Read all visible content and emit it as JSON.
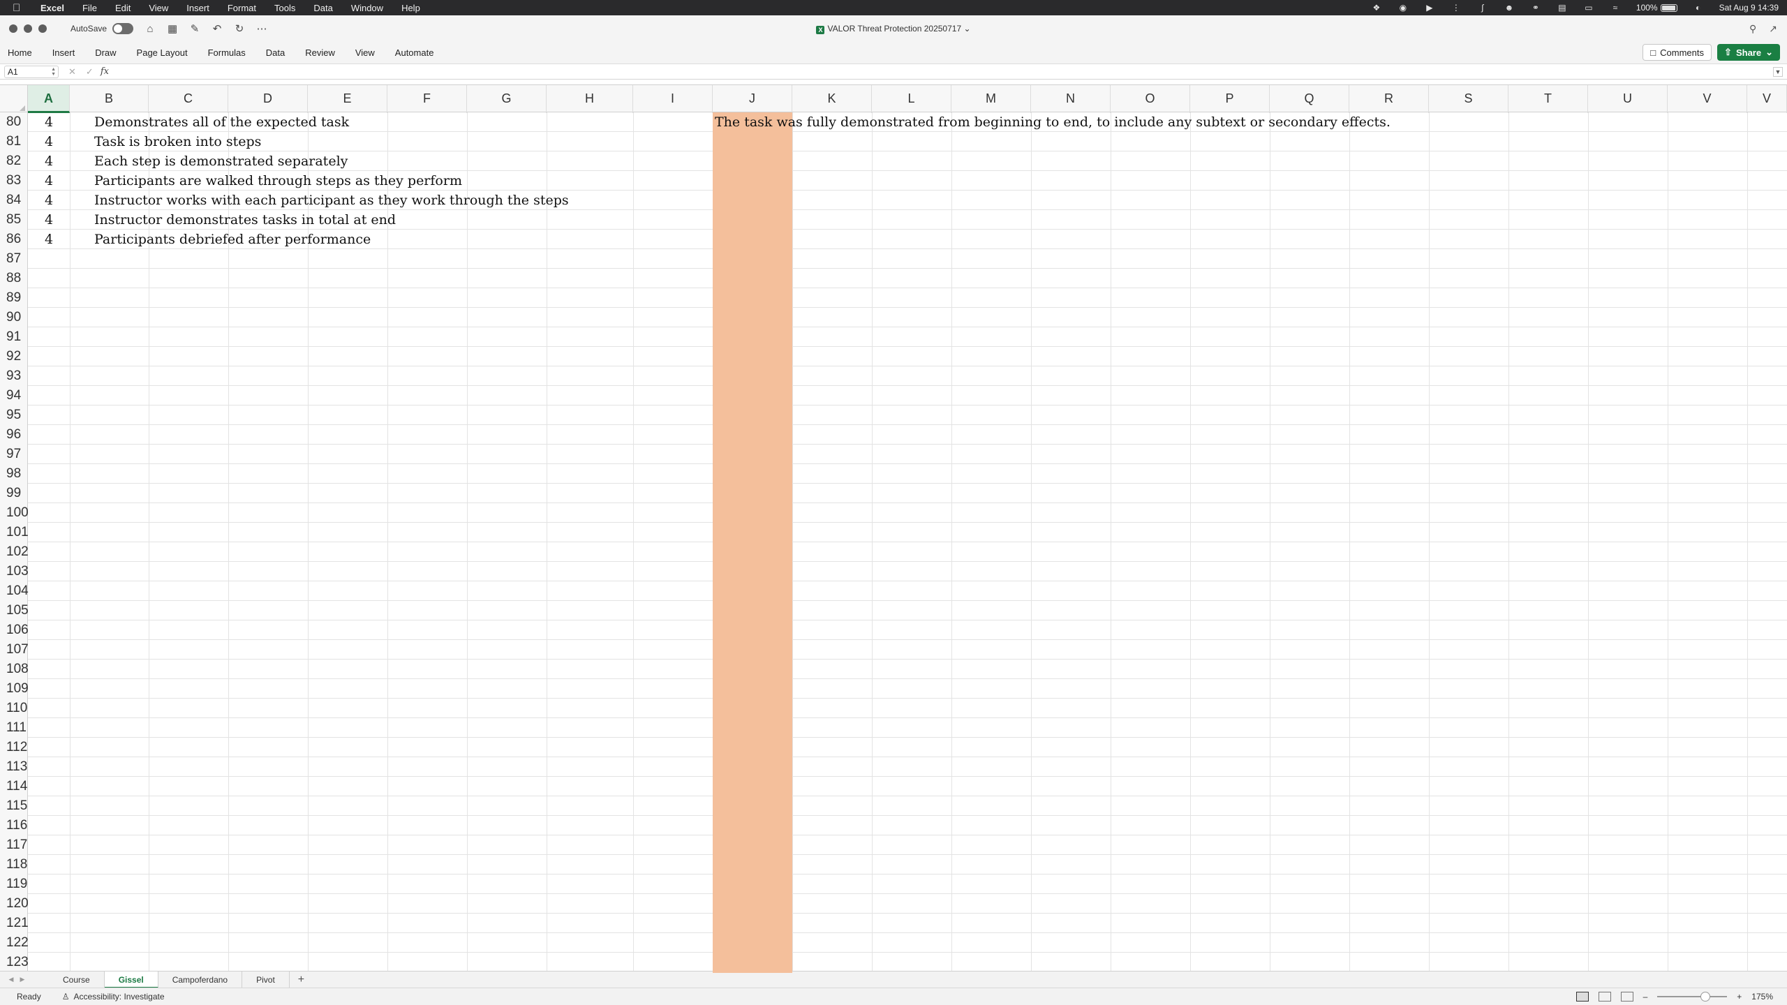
{
  "menubar": {
    "apple": "",
    "items": [
      "Excel",
      "File",
      "Edit",
      "View",
      "Insert",
      "Format",
      "Tools",
      "Data",
      "Window",
      "Help"
    ],
    "battery": "100%",
    "datetime": "Sat Aug 9  14:39"
  },
  "titlebar": {
    "autosave_label": "AutoSave",
    "doc_title": "VALOR Threat Protection 20250717",
    "excel_glyph": "X"
  },
  "ribbon": {
    "tabs": [
      "Home",
      "Insert",
      "Draw",
      "Page Layout",
      "Formulas",
      "Data",
      "Review",
      "View",
      "Automate"
    ],
    "comments_label": "Comments",
    "share_label": "Share"
  },
  "formula_bar": {
    "name_box": "A1",
    "fx": "fx",
    "value": ""
  },
  "columns": [
    "A",
    "B",
    "C",
    "D",
    "E",
    "F",
    "G",
    "H",
    "I",
    "J",
    "K",
    "L",
    "M",
    "N",
    "O",
    "P",
    "Q",
    "R",
    "S",
    "T",
    "U",
    "V",
    "V"
  ],
  "selected_column": "A",
  "filled_column": {
    "letter": "J",
    "color": "#f4bf9b"
  },
  "rows": [
    {
      "num": "80",
      "a": "4",
      "b": "Demonstrates all of the expected task",
      "j": "The task was fully demonstrated from beginning to end, to include any subtext or secondary effects."
    },
    {
      "num": "81",
      "a": "4",
      "b": "Task is broken into steps",
      "j": ""
    },
    {
      "num": "82",
      "a": "4",
      "b": "Each step is demonstrated separately",
      "j": ""
    },
    {
      "num": "83",
      "a": "4",
      "b": "Participants are walked through steps as they perform",
      "j": ""
    },
    {
      "num": "84",
      "a": "4",
      "b": "Instructor works with each participant as they work through the steps",
      "j": ""
    },
    {
      "num": "85",
      "a": "4",
      "b": "Instructor demonstrates tasks in total at end",
      "j": ""
    },
    {
      "num": "86",
      "a": "4",
      "b": "Participants debriefed after performance",
      "j": ""
    },
    {
      "num": "87",
      "a": "",
      "b": "",
      "j": ""
    },
    {
      "num": "88",
      "a": "",
      "b": "",
      "j": ""
    },
    {
      "num": "89",
      "a": "",
      "b": "",
      "j": ""
    },
    {
      "num": "90",
      "a": "",
      "b": "",
      "j": ""
    },
    {
      "num": "91",
      "a": "",
      "b": "",
      "j": ""
    },
    {
      "num": "92",
      "a": "",
      "b": "",
      "j": ""
    },
    {
      "num": "93",
      "a": "",
      "b": "",
      "j": ""
    },
    {
      "num": "94",
      "a": "",
      "b": "",
      "j": ""
    },
    {
      "num": "95",
      "a": "",
      "b": "",
      "j": ""
    },
    {
      "num": "96",
      "a": "",
      "b": "",
      "j": ""
    },
    {
      "num": "97",
      "a": "",
      "b": "",
      "j": ""
    },
    {
      "num": "98",
      "a": "",
      "b": "",
      "j": ""
    },
    {
      "num": "99",
      "a": "",
      "b": "",
      "j": ""
    },
    {
      "num": "100",
      "a": "",
      "b": "",
      "j": ""
    },
    {
      "num": "101",
      "a": "",
      "b": "",
      "j": ""
    },
    {
      "num": "102",
      "a": "",
      "b": "",
      "j": ""
    },
    {
      "num": "103",
      "a": "",
      "b": "",
      "j": ""
    },
    {
      "num": "104",
      "a": "",
      "b": "",
      "j": ""
    },
    {
      "num": "105",
      "a": "",
      "b": "",
      "j": ""
    },
    {
      "num": "106",
      "a": "",
      "b": "",
      "j": ""
    },
    {
      "num": "107",
      "a": "",
      "b": "",
      "j": ""
    },
    {
      "num": "108",
      "a": "",
      "b": "",
      "j": ""
    },
    {
      "num": "109",
      "a": "",
      "b": "",
      "j": ""
    },
    {
      "num": "110",
      "a": "",
      "b": "",
      "j": ""
    },
    {
      "num": "111",
      "a": "",
      "b": "",
      "j": ""
    },
    {
      "num": "112",
      "a": "",
      "b": "",
      "j": ""
    },
    {
      "num": "113",
      "a": "",
      "b": "",
      "j": ""
    },
    {
      "num": "114",
      "a": "",
      "b": "",
      "j": ""
    },
    {
      "num": "115",
      "a": "",
      "b": "",
      "j": ""
    },
    {
      "num": "116",
      "a": "",
      "b": "",
      "j": ""
    },
    {
      "num": "117",
      "a": "",
      "b": "",
      "j": ""
    },
    {
      "num": "118",
      "a": "",
      "b": "",
      "j": ""
    },
    {
      "num": "119",
      "a": "",
      "b": "",
      "j": ""
    },
    {
      "num": "120",
      "a": "",
      "b": "",
      "j": ""
    },
    {
      "num": "121",
      "a": "",
      "b": "",
      "j": ""
    },
    {
      "num": "122",
      "a": "",
      "b": "",
      "j": ""
    },
    {
      "num": "123",
      "a": "",
      "b": "",
      "j": ""
    }
  ],
  "sheet_tabs": {
    "tabs": [
      "Course",
      "Gissel",
      "Campoferdano",
      "Pivot"
    ],
    "active": "Gissel",
    "add_label": "+"
  },
  "statusbar": {
    "ready": "Ready",
    "accessibility": "Accessibility: Investigate",
    "zoom": "175%"
  }
}
